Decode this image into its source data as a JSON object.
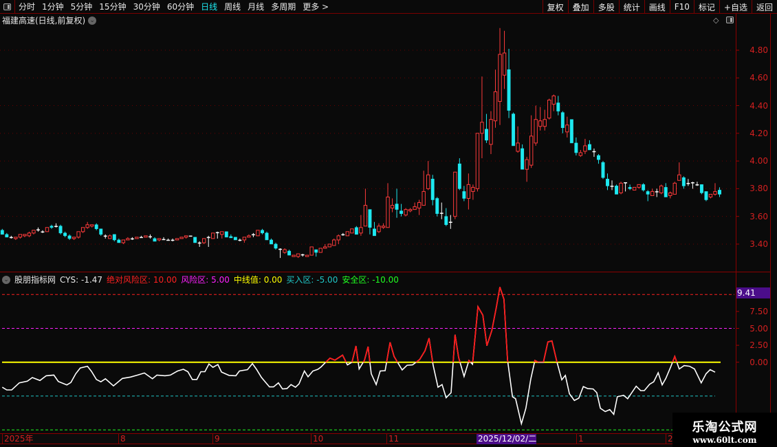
{
  "toolbar": {
    "periods": [
      "分时",
      "1分钟",
      "5分钟",
      "15分钟",
      "30分钟",
      "60分钟",
      "日线",
      "周线",
      "月线",
      "多周期",
      "更多 >"
    ],
    "active_period": "日线",
    "right_buttons": [
      "复权",
      "叠加",
      "多股",
      "统计",
      "画线",
      "F10",
      "标记",
      "+自选",
      "返回"
    ]
  },
  "chart_title": "福建高速(日线,前复权)",
  "colors": {
    "up": "#ff3b3b",
    "down": "#1ee8f0",
    "doji": "#ffffff",
    "grid": "#6a0000",
    "cys": "#ffffff",
    "cys_hot": "#ff1a1a"
  },
  "price_axis": {
    "ticks": [
      "4.80",
      "4.60",
      "4.40",
      "4.20",
      "4.00",
      "3.80",
      "3.60",
      "3.40"
    ]
  },
  "indicator": {
    "name": "股朋指标网",
    "cys_label": "CYS: -1.47",
    "levels": [
      {
        "label": "绝对风险区: 10.00",
        "value": 10,
        "color": "#ff2020"
      },
      {
        "label": "风险区: 5.00",
        "value": 5,
        "color": "#ff20ff"
      },
      {
        "label": "中线值: 0.00",
        "value": 0,
        "color": "#ffff00"
      },
      {
        "label": "买入区: -5.00",
        "value": -5,
        "color": "#20c8c8"
      },
      {
        "label": "安全区: -10.00",
        "value": -10,
        "color": "#20ff20"
      }
    ],
    "current_box": "9.41",
    "axis_ticks": [
      "7.50",
      "5.00",
      "2.50",
      "0.00"
    ]
  },
  "date_axis": {
    "labels": [
      "2025年",
      "8",
      "9",
      "10",
      "11",
      "2025/12/02/二",
      "1",
      "2"
    ],
    "highlighted": "2025/12/02/二"
  },
  "watermark": {
    "name": "乐淘公式网",
    "url": "www.60lt.com"
  },
  "chart_data": {
    "type": "candlestick",
    "ylim": [
      3.4,
      4.8
    ],
    "ohlc": [
      [
        3.5,
        3.51,
        3.47,
        3.47
      ],
      [
        3.47,
        3.48,
        3.45,
        3.45
      ],
      [
        3.45,
        3.46,
        3.44,
        3.445
      ],
      [
        3.44,
        3.45,
        3.43,
        3.45
      ],
      [
        3.45,
        3.47,
        3.44,
        3.47
      ],
      [
        3.46,
        3.47,
        3.45,
        3.47
      ],
      [
        3.46,
        3.49,
        3.45,
        3.48
      ],
      [
        3.48,
        3.5,
        3.47,
        3.5
      ],
      [
        3.505,
        3.52,
        3.49,
        3.5
      ],
      [
        3.49,
        3.5,
        3.48,
        3.49
      ],
      [
        3.49,
        3.52,
        3.49,
        3.52
      ],
      [
        3.53,
        3.54,
        3.51,
        3.52
      ],
      [
        3.53,
        3.55,
        3.52,
        3.525
      ],
      [
        3.53,
        3.54,
        3.47,
        3.48
      ],
      [
        3.48,
        3.49,
        3.45,
        3.46
      ],
      [
        3.46,
        3.47,
        3.43,
        3.44
      ],
      [
        3.44,
        3.45,
        3.43,
        3.45
      ],
      [
        3.45,
        3.49,
        3.44,
        3.49
      ],
      [
        3.49,
        3.52,
        3.48,
        3.52
      ],
      [
        3.52,
        3.56,
        3.51,
        3.54
      ],
      [
        3.53,
        3.54,
        3.52,
        3.54
      ],
      [
        3.54,
        3.55,
        3.5,
        3.51
      ],
      [
        3.51,
        3.51,
        3.46,
        3.47
      ],
      [
        3.46,
        3.47,
        3.44,
        3.455
      ],
      [
        3.44,
        3.47,
        3.44,
        3.46
      ],
      [
        3.47,
        3.47,
        3.42,
        3.43
      ],
      [
        3.43,
        3.44,
        3.41,
        3.41
      ],
      [
        3.41,
        3.43,
        3.4,
        3.43
      ],
      [
        3.43,
        3.45,
        3.43,
        3.44
      ],
      [
        3.44,
        3.45,
        3.43,
        3.44
      ],
      [
        3.44,
        3.45,
        3.44,
        3.45
      ],
      [
        3.45,
        3.46,
        3.45,
        3.45
      ],
      [
        3.45,
        3.46,
        3.45,
        3.46
      ],
      [
        3.455,
        3.47,
        3.44,
        3.45
      ],
      [
        3.44,
        3.45,
        3.42,
        3.42
      ],
      [
        3.43,
        3.44,
        3.42,
        3.44
      ],
      [
        3.435,
        3.45,
        3.43,
        3.435
      ],
      [
        3.43,
        3.44,
        3.43,
        3.43
      ],
      [
        3.43,
        3.44,
        3.42,
        3.43
      ],
      [
        3.43,
        3.44,
        3.43,
        3.44
      ],
      [
        3.44,
        3.45,
        3.44,
        3.45
      ],
      [
        3.45,
        3.46,
        3.44,
        3.46
      ],
      [
        3.46,
        3.46,
        3.455,
        3.455
      ],
      [
        3.45,
        3.45,
        3.41,
        3.41
      ],
      [
        3.41,
        3.42,
        3.38,
        3.405
      ],
      [
        3.41,
        3.44,
        3.4,
        3.44
      ],
      [
        3.45,
        3.46,
        3.38,
        3.445
      ],
      [
        3.44,
        3.48,
        3.44,
        3.48
      ],
      [
        3.485,
        3.49,
        3.44,
        3.48
      ],
      [
        3.47,
        3.49,
        3.44,
        3.49
      ],
      [
        3.49,
        3.49,
        3.45,
        3.45
      ],
      [
        3.455,
        3.47,
        3.45,
        3.445
      ],
      [
        3.45,
        3.45,
        3.43,
        3.43
      ],
      [
        3.43,
        3.44,
        3.42,
        3.43
      ],
      [
        3.43,
        3.45,
        3.41,
        3.45
      ],
      [
        3.45,
        3.47,
        3.45,
        3.46
      ],
      [
        3.47,
        3.48,
        3.45,
        3.465
      ],
      [
        3.46,
        3.5,
        3.46,
        3.5
      ],
      [
        3.5,
        3.51,
        3.47,
        3.48
      ],
      [
        3.48,
        3.49,
        3.43,
        3.43
      ],
      [
        3.43,
        3.44,
        3.4,
        3.4
      ],
      [
        3.4,
        3.41,
        3.36,
        3.37
      ],
      [
        3.365,
        3.37,
        3.3,
        3.36
      ],
      [
        3.34,
        3.37,
        3.33,
        3.36
      ],
      [
        3.35,
        3.36,
        3.32,
        3.32
      ],
      [
        3.31,
        3.32,
        3.31,
        3.32
      ],
      [
        3.31,
        3.33,
        3.3,
        3.33
      ],
      [
        3.325,
        3.33,
        3.31,
        3.32
      ],
      [
        3.31,
        3.32,
        3.31,
        3.32
      ],
      [
        3.32,
        3.38,
        3.32,
        3.38
      ],
      [
        3.36,
        3.36,
        3.31,
        3.34
      ],
      [
        3.34,
        3.37,
        3.34,
        3.37
      ],
      [
        3.37,
        3.4,
        3.37,
        3.38
      ],
      [
        3.38,
        3.4,
        3.38,
        3.4
      ],
      [
        3.39,
        3.44,
        3.39,
        3.43
      ],
      [
        3.43,
        3.47,
        3.4,
        3.46
      ],
      [
        3.47,
        3.48,
        3.46,
        3.465
      ],
      [
        3.46,
        3.49,
        3.46,
        3.49
      ],
      [
        3.48,
        3.51,
        3.48,
        3.51
      ],
      [
        3.52,
        3.53,
        3.47,
        3.47
      ],
      [
        3.48,
        3.61,
        3.46,
        3.52
      ],
      [
        3.53,
        3.8,
        3.53,
        3.68
      ],
      [
        3.65,
        3.65,
        3.47,
        3.52
      ],
      [
        3.51,
        3.56,
        3.46,
        3.46
      ],
      [
        3.49,
        3.55,
        3.48,
        3.53
      ],
      [
        3.52,
        3.55,
        3.51,
        3.53
      ],
      [
        3.52,
        3.84,
        3.52,
        3.74
      ],
      [
        3.66,
        3.73,
        3.63,
        3.68
      ],
      [
        3.69,
        3.8,
        3.59,
        3.65
      ],
      [
        3.64,
        3.69,
        3.6,
        3.62
      ],
      [
        3.61,
        3.66,
        3.6,
        3.65
      ],
      [
        3.64,
        3.66,
        3.63,
        3.65
      ],
      [
        3.65,
        3.7,
        3.65,
        3.67
      ],
      [
        3.66,
        3.72,
        3.61,
        3.7
      ],
      [
        3.68,
        3.93,
        3.68,
        3.78
      ],
      [
        3.8,
        4.0,
        3.79,
        3.9
      ],
      [
        3.87,
        3.9,
        3.68,
        3.72
      ],
      [
        3.73,
        3.74,
        3.6,
        3.62
      ],
      [
        3.625,
        3.7,
        3.58,
        3.625
      ],
      [
        3.6,
        3.66,
        3.53,
        3.54
      ],
      [
        3.56,
        3.61,
        3.51,
        3.56
      ],
      [
        3.6,
        3.92,
        3.58,
        3.92
      ],
      [
        3.98,
        4.02,
        3.79,
        3.8
      ],
      [
        3.78,
        3.82,
        3.71,
        3.73
      ],
      [
        3.73,
        3.91,
        3.65,
        3.83
      ],
      [
        3.78,
        3.83,
        3.72,
        3.81
      ],
      [
        3.8,
        4.2,
        3.78,
        4.2
      ],
      [
        4.2,
        4.61,
        4.02,
        4.28
      ],
      [
        4.23,
        4.34,
        4.13,
        4.15
      ],
      [
        4.12,
        4.36,
        4.05,
        4.3
      ],
      [
        4.29,
        4.66,
        4.24,
        4.5
      ],
      [
        4.43,
        4.96,
        4.26,
        4.77
      ],
      [
        4.62,
        4.94,
        4.52,
        4.78
      ],
      [
        4.66,
        4.81,
        4.31,
        4.365
      ],
      [
        4.34,
        4.35,
        4.11,
        4.11
      ],
      [
        4.07,
        4.25,
        4.06,
        4.13
      ],
      [
        4.09,
        4.12,
        3.94,
        3.94
      ],
      [
        3.94,
        4.03,
        3.85,
        4.01
      ],
      [
        3.97,
        4.33,
        3.95,
        4.18
      ],
      [
        4.13,
        4.4,
        4.11,
        4.3
      ],
      [
        4.25,
        4.39,
        4.22,
        4.29
      ],
      [
        4.25,
        4.37,
        4.22,
        4.3
      ],
      [
        4.31,
        4.45,
        4.3,
        4.44
      ],
      [
        4.41,
        4.48,
        4.36,
        4.47
      ],
      [
        4.42,
        4.47,
        4.33,
        4.36
      ],
      [
        4.35,
        4.36,
        4.2,
        4.24
      ],
      [
        4.21,
        4.32,
        4.17,
        4.26
      ],
      [
        4.3,
        4.3,
        4.13,
        4.13
      ],
      [
        4.13,
        4.17,
        4.04,
        4.06
      ],
      [
        4.04,
        4.08,
        4.03,
        4.06
      ],
      [
        4.07,
        4.16,
        4.05,
        4.11
      ],
      [
        4.12,
        4.15,
        4.08,
        4.08
      ],
      [
        4.07,
        4.09,
        4.03,
        4.065
      ],
      [
        4.04,
        4.05,
        3.98,
        4.01
      ],
      [
        3.99,
        4.0,
        3.87,
        3.88
      ],
      [
        3.87,
        3.91,
        3.79,
        3.82
      ],
      [
        3.82,
        3.86,
        3.79,
        3.815
      ],
      [
        3.82,
        3.83,
        3.76,
        3.76
      ],
      [
        3.77,
        3.85,
        3.76,
        3.84
      ],
      [
        3.845,
        3.845,
        3.78,
        3.84
      ],
      [
        3.81,
        3.83,
        3.79,
        3.8
      ],
      [
        3.79,
        3.81,
        3.79,
        3.81
      ],
      [
        3.81,
        3.83,
        3.8,
        3.83
      ],
      [
        3.83,
        3.84,
        3.78,
        3.79
      ],
      [
        3.78,
        3.79,
        3.71,
        3.76
      ],
      [
        3.75,
        3.8,
        3.75,
        3.78
      ],
      [
        3.78,
        3.8,
        3.74,
        3.78
      ],
      [
        3.77,
        3.83,
        3.76,
        3.82
      ],
      [
        3.81,
        3.84,
        3.74,
        3.74
      ],
      [
        3.75,
        3.78,
        3.73,
        3.77
      ],
      [
        3.76,
        3.85,
        3.76,
        3.84
      ],
      [
        3.86,
        3.99,
        3.86,
        3.9
      ],
      [
        3.88,
        3.89,
        3.8,
        3.82
      ],
      [
        3.84,
        3.87,
        3.82,
        3.84
      ],
      [
        3.845,
        3.85,
        3.8,
        3.845
      ],
      [
        3.83,
        3.85,
        3.82,
        3.83
      ],
      [
        3.83,
        3.83,
        3.76,
        3.77
      ],
      [
        3.78,
        3.78,
        3.71,
        3.72
      ],
      [
        3.74,
        3.76,
        3.73,
        3.76
      ],
      [
        3.76,
        3.84,
        3.75,
        3.78
      ],
      [
        3.79,
        3.81,
        3.74,
        3.76
      ]
    ],
    "cys_ylim": [
      -10,
      10
    ],
    "cys": [
      [
        0,
        -3.7
      ],
      [
        1,
        -4.1
      ],
      [
        2.1,
        -4.1
      ],
      [
        3.8,
        -3.05
      ],
      [
        5.6,
        -2.8
      ],
      [
        6.7,
        -2.27
      ],
      [
        8.4,
        -2.7
      ],
      [
        9.8,
        -2.0
      ],
      [
        11.5,
        -1.9
      ],
      [
        12.5,
        -2.85
      ],
      [
        14.4,
        -3.35
      ],
      [
        15.3,
        -3.0
      ],
      [
        16.4,
        -1.7
      ],
      [
        17.4,
        -0.85
      ],
      [
        19,
        -0.6
      ],
      [
        19.9,
        -1.35
      ],
      [
        21,
        -2.55
      ],
      [
        22,
        -2.9
      ],
      [
        23,
        -2.45
      ],
      [
        24.8,
        -3.5
      ],
      [
        26.8,
        -2.4
      ],
      [
        28.6,
        -2.2
      ],
      [
        30.2,
        -1.9
      ],
      [
        31.7,
        -1.6
      ],
      [
        33.5,
        -2.45
      ],
      [
        34.5,
        -1.9
      ],
      [
        36.3,
        -2.0
      ],
      [
        37.5,
        -1.9
      ],
      [
        39.1,
        -1.3
      ],
      [
        40.4,
        -1.05
      ],
      [
        41.4,
        -1.4
      ],
      [
        42.4,
        -2.55
      ],
      [
        43.4,
        -2.55
      ],
      [
        44.3,
        -1.4
      ],
      [
        45.2,
        -1.4
      ],
      [
        46.1,
        -0.25
      ],
      [
        47,
        -0.75
      ],
      [
        48.1,
        -0.35
      ],
      [
        48.9,
        -1.45
      ],
      [
        50.6,
        -1.95
      ],
      [
        52.1,
        -2.0
      ],
      [
        52.9,
        -1.3
      ],
      [
        54.7,
        -1.1
      ],
      [
        55.8,
        -0.2
      ],
      [
        56.7,
        -1.05
      ],
      [
        57.8,
        -2.25
      ],
      [
        59.6,
        -3.65
      ],
      [
        60.5,
        -3.65
      ],
      [
        61.6,
        -3.05
      ],
      [
        62.5,
        -3.95
      ],
      [
        63.5,
        -3.9
      ],
      [
        64.4,
        -3.3
      ],
      [
        65.4,
        -3.7
      ],
      [
        66.2,
        -3.2
      ],
      [
        67.4,
        -1.3
      ],
      [
        68.2,
        -2.15
      ],
      [
        69.3,
        -1.3
      ],
      [
        70.4,
        -1.05
      ],
      [
        71.1,
        -0.7
      ],
      [
        72,
        -0.1
      ],
      [
        73.1,
        0.6
      ],
      [
        74.2,
        0.3
      ],
      [
        75.9,
        1.05
      ],
      [
        77,
        -0.4
      ],
      [
        78,
        0
      ],
      [
        78.9,
        2.4
      ],
      [
        79.6,
        -1.0
      ],
      [
        80.8,
        0.3
      ],
      [
        81.6,
        2.3
      ],
      [
        82.3,
        -1.7
      ],
      [
        83.4,
        -3.3
      ],
      [
        84.3,
        -1.3
      ],
      [
        85.4,
        -1.25
      ],
      [
        86.5,
        2.95
      ],
      [
        87.4,
        0.85
      ],
      [
        89.2,
        -1.15
      ],
      [
        90.3,
        -0.45
      ],
      [
        91.5,
        -0.4
      ],
      [
        93.1,
        0.4
      ],
      [
        94.3,
        1.7
      ],
      [
        95.2,
        3.55
      ],
      [
        96.1,
        -0.45
      ],
      [
        97.2,
        -3.7
      ],
      [
        98.1,
        -3.3
      ],
      [
        99,
        -5.25
      ],
      [
        100.1,
        -4.5
      ],
      [
        101,
        4.05
      ],
      [
        101.8,
        0.7
      ],
      [
        103,
        -2.1
      ],
      [
        104.1,
        0.25
      ],
      [
        104.9,
        -0.3
      ],
      [
        106.1,
        8.2
      ],
      [
        107.2,
        6.95
      ],
      [
        108.1,
        2.45
      ],
      [
        109.2,
        4.7
      ],
      [
        110.2,
        8.1
      ],
      [
        111,
        11.1
      ],
      [
        111.9,
        9.3
      ],
      [
        112.7,
        0.35
      ],
      [
        113.8,
        -5.1
      ],
      [
        114.5,
        -5.4
      ],
      [
        115.8,
        -9.1
      ],
      [
        116.8,
        -6.8
      ],
      [
        117.9,
        -2.45
      ],
      [
        118.8,
        0.25
      ],
      [
        119.6,
        0
      ],
      [
        120.7,
        0
      ],
      [
        121.7,
        3.0
      ],
      [
        122.6,
        3.15
      ],
      [
        123.7,
        0.1
      ],
      [
        124.8,
        -2.6
      ],
      [
        125.6,
        -1.95
      ],
      [
        126.5,
        -4.65
      ],
      [
        127.6,
        -5.65
      ],
      [
        128.6,
        -5.3
      ],
      [
        129.6,
        -3.6
      ],
      [
        130.6,
        -3.9
      ],
      [
        131.8,
        -3.95
      ],
      [
        132.6,
        -4.5
      ],
      [
        133.4,
        -6.8
      ],
      [
        134.5,
        -7.3
      ],
      [
        135.5,
        -7.0
      ],
      [
        136.4,
        -7.7
      ],
      [
        137.2,
        -5.1
      ],
      [
        138.6,
        -4.9
      ],
      [
        139.5,
        -5.4
      ],
      [
        141.4,
        -3.55
      ],
      [
        142.4,
        -4.2
      ],
      [
        143.2,
        -4.2
      ],
      [
        144.4,
        -3.25
      ],
      [
        145.3,
        -2.9
      ],
      [
        146.3,
        -1.55
      ],
      [
        147.2,
        -3.35
      ],
      [
        148,
        -2.4
      ],
      [
        149.1,
        -0.7
      ],
      [
        150,
        0.85
      ],
      [
        151,
        -1.0
      ],
      [
        152.1,
        -0.5
      ],
      [
        153.3,
        -0.6
      ],
      [
        154.4,
        -1.0
      ],
      [
        155.9,
        -3.05
      ],
      [
        157,
        -1.7
      ],
      [
        157.9,
        -1.1
      ],
      [
        159,
        -1.47
      ]
    ]
  }
}
